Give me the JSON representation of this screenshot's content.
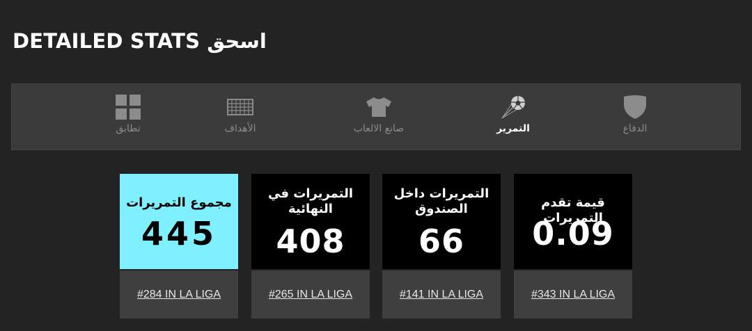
{
  "page": {
    "title": "اسحق DETAILED STATS"
  },
  "tabs": [
    {
      "label": "تطابق",
      "icon": "grid-icon",
      "active": false
    },
    {
      "label": "الأهداف",
      "icon": "goal-net-icon",
      "active": false
    },
    {
      "label": "صانع الالعاب",
      "icon": "shirt-icon",
      "active": false
    },
    {
      "label": "التمرير",
      "icon": "ball-pass-icon",
      "active": true
    },
    {
      "label": "الدفاع",
      "icon": "shield-icon",
      "active": false
    }
  ],
  "cards": [
    {
      "label": "مجموع التمريرات",
      "value": "445",
      "rank": "#284 IN LA LIGA",
      "highlight": true
    },
    {
      "label": "التمريرات في النهائية",
      "value": "408",
      "rank": "#265 IN LA LIGA",
      "highlight": false
    },
    {
      "label": "التمريرات داخل الصندوق",
      "value": "66",
      "rank": "#141 IN LA LIGA",
      "highlight": false
    },
    {
      "label": "قيمة تقدم التمريرات",
      "value": "0.09",
      "rank": "#343 IN LA LIGA",
      "highlight": false
    }
  ],
  "colors": {
    "background": "#232323",
    "tabbar": "#3b3b3b",
    "highlight_card": "#7ff0ff",
    "card": "#000000",
    "rank_box": "#3f3f3f"
  }
}
